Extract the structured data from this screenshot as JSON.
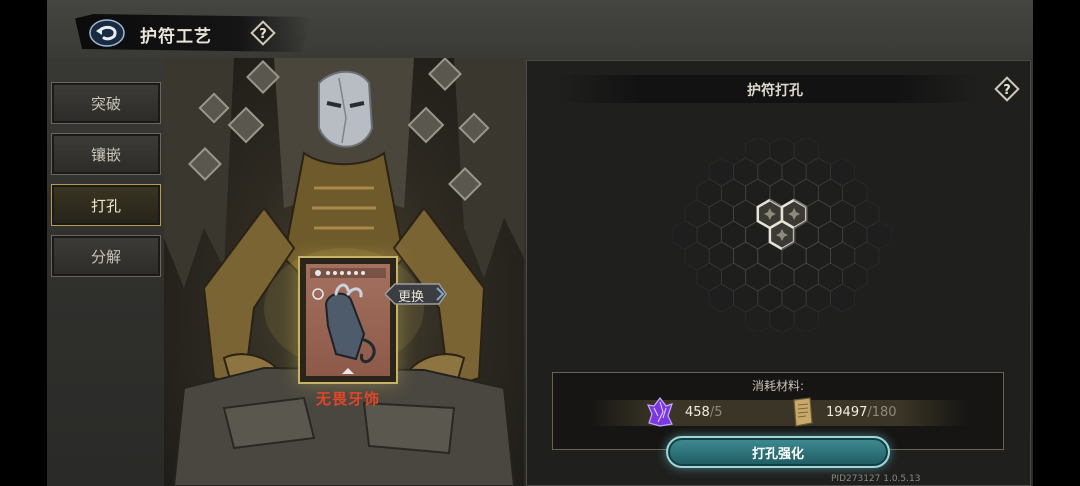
{
  "header": {
    "title": "护符工艺",
    "help_icon": "question-diamond-icon",
    "back_icon": "back-arrow-icon"
  },
  "tabs": [
    {
      "label": "突破",
      "active": false
    },
    {
      "label": "镶嵌",
      "active": false
    },
    {
      "label": "打孔",
      "active": true
    },
    {
      "label": "分解",
      "active": false
    }
  ],
  "item": {
    "name": "无畏牙饰",
    "swap_label": "更换",
    "card_icon": "claw-hand-icon"
  },
  "panel": {
    "title": "护符打孔",
    "help_icon": "question-diamond-icon"
  },
  "materials": {
    "label": "消耗材料:",
    "items": [
      {
        "icon": "purple-crystal-icon",
        "have": "458",
        "need": "/5"
      },
      {
        "icon": "scroll-icon",
        "have": "19497",
        "need": "/180"
      }
    ]
  },
  "action_button": "打孔强化",
  "version": "PID273127 1.0.5.13",
  "colors": {
    "accent_gold": "#b79a4e",
    "item_name_red": "#e04628",
    "button_teal": "#3f8d93",
    "crystal_purple": "#8c4cf0"
  }
}
